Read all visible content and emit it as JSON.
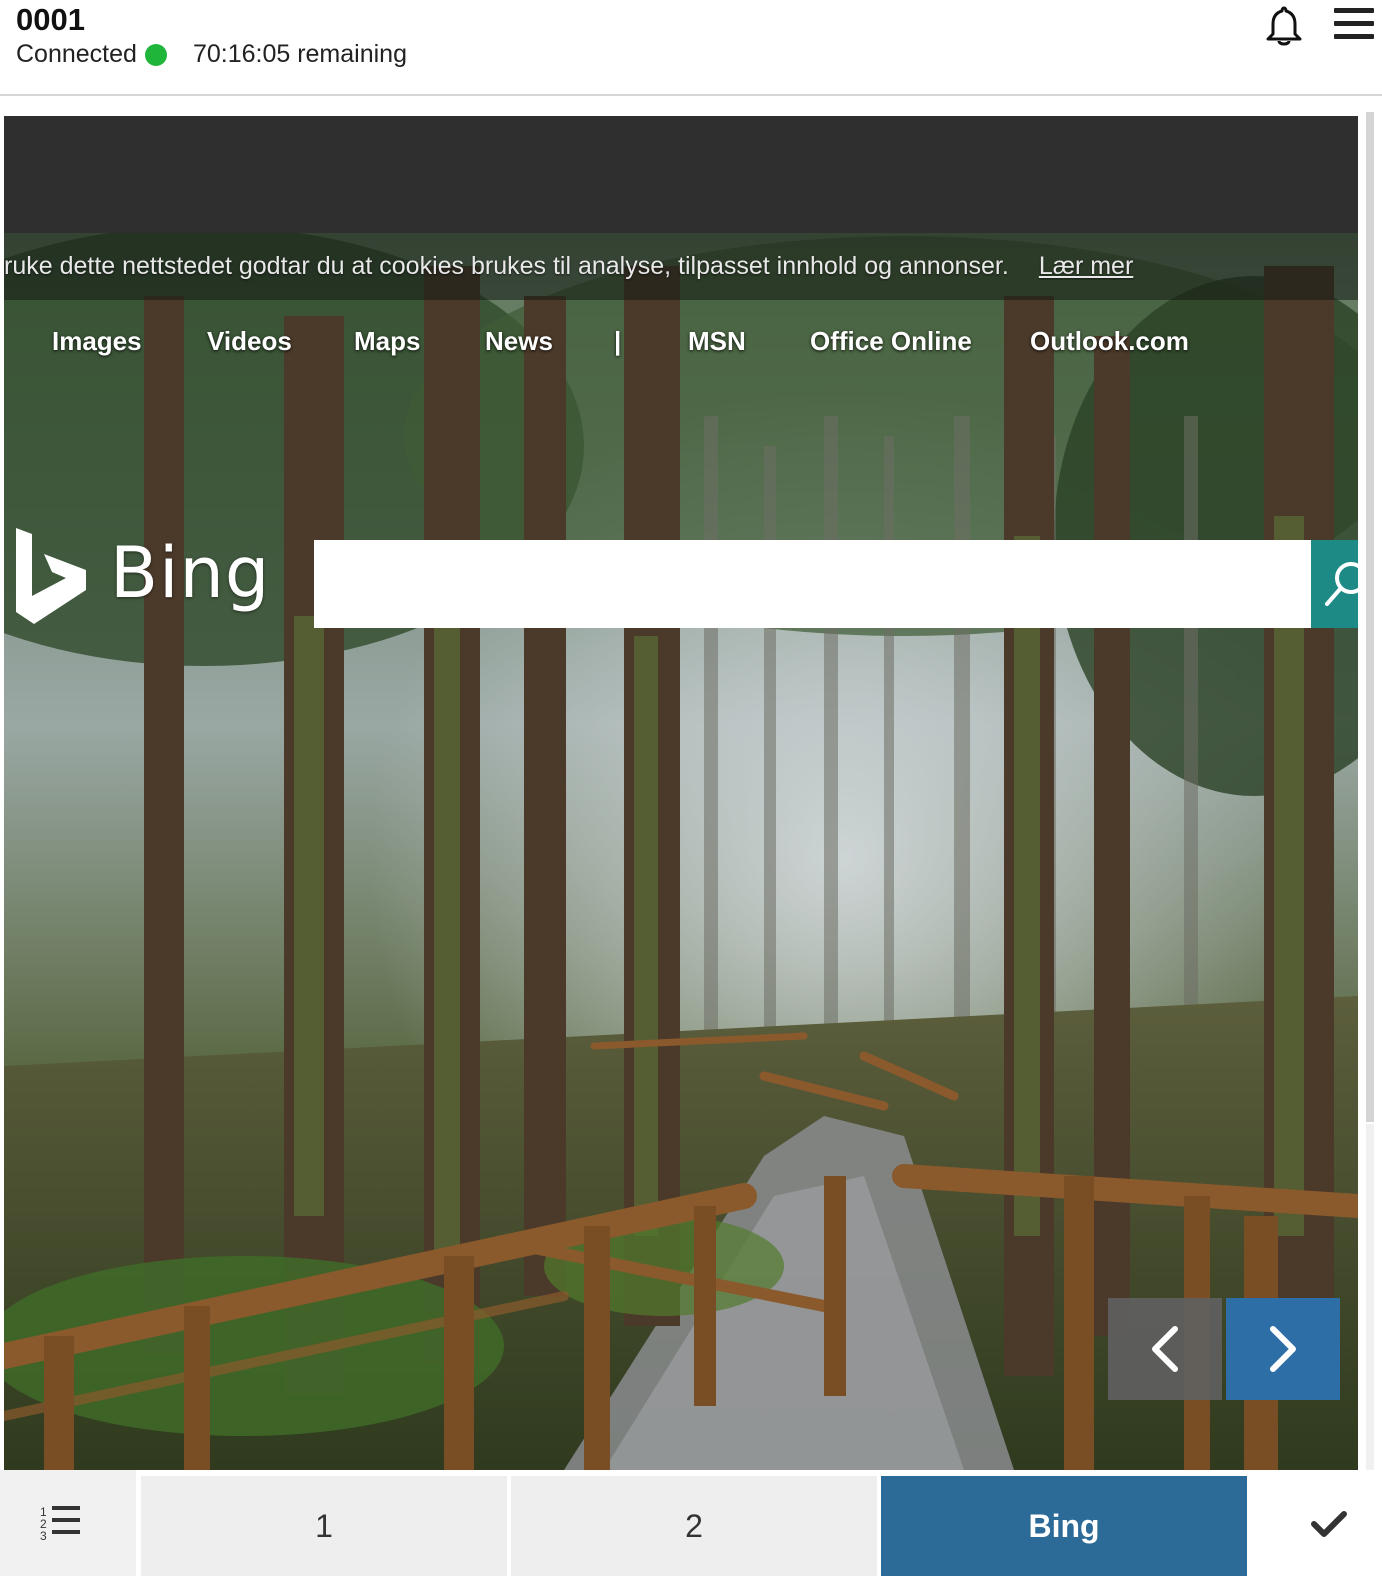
{
  "header": {
    "session_id": "0001",
    "status_label": "Connected",
    "status_color": "#1fb53a",
    "time_remaining": "70:16:05 remaining",
    "icons": [
      "bell-icon",
      "hamburger-menu-icon"
    ]
  },
  "browser": {
    "cookie_notice": "ruke dette nettstedet godtar du at cookies brukes til analyse, tilpasset innhold og annonser.",
    "cookie_link": "Lær mer",
    "nav": {
      "images": "Images",
      "videos": "Videos",
      "maps": "Maps",
      "news": "News",
      "separator": "|",
      "msn": "MSN",
      "office": "Office Online",
      "outlook": "Outlook.com"
    },
    "logo_text": "Bing",
    "search_value": "",
    "search_accent": "#1d8a86",
    "carousel_icons": [
      "chevron-left-icon",
      "chevron-right-icon"
    ]
  },
  "bottom_bar": {
    "tabs": [
      {
        "label": "1"
      },
      {
        "label": "2"
      },
      {
        "label": "Bing",
        "active": true
      }
    ],
    "active_color": "#2c6a98",
    "icons": [
      "numbered-list-icon",
      "checkmark-icon"
    ]
  }
}
